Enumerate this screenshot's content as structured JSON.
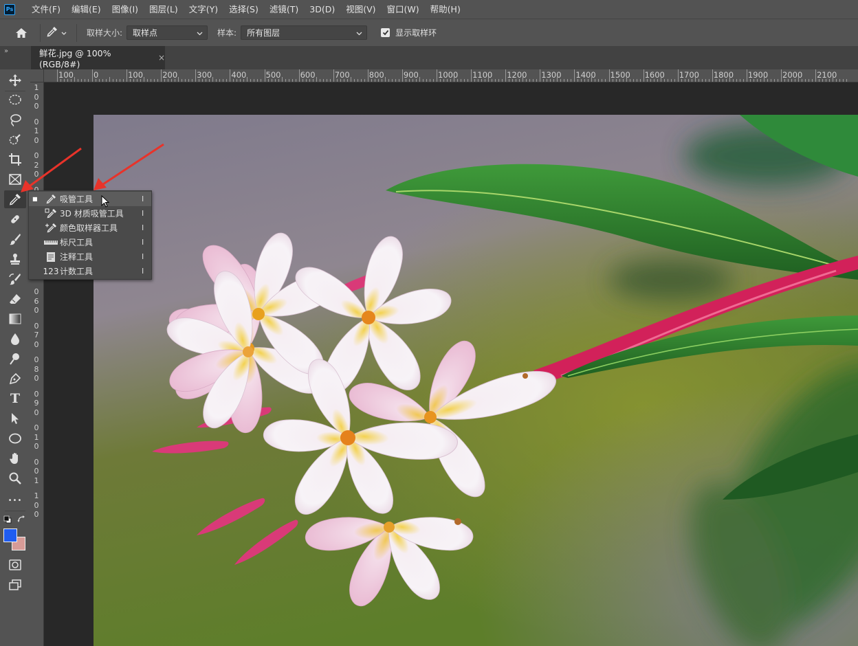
{
  "app": {
    "logo": "Ps"
  },
  "menu": [
    "文件(F)",
    "编辑(E)",
    "图像(I)",
    "图层(L)",
    "文字(Y)",
    "选择(S)",
    "滤镜(T)",
    "3D(D)",
    "视图(V)",
    "窗口(W)",
    "帮助(H)"
  ],
  "options": {
    "sample_size_label": "取样大小:",
    "sample_size_value": "取样点",
    "sample_label": "样本:",
    "sample_value": "所有图层",
    "show_ring_label": "显示取样环",
    "show_ring_checked": true
  },
  "tabs": {
    "collapse": "»",
    "document_title": "鲜花.jpg @ 100%(RGB/8#)",
    "close": "×"
  },
  "ruler": {
    "top_labels": [
      "100",
      "0",
      "100",
      "200",
      "300",
      "400",
      "500",
      "600",
      "700",
      "800",
      "900",
      "1000",
      "1100",
      "1200",
      "1300",
      "1400",
      "1500",
      "1600",
      "1700",
      "1800",
      "1900",
      "2000",
      "2100"
    ],
    "left_labels": [
      "1",
      "0",
      "0",
      "0",
      "1",
      "0",
      "0",
      "2",
      "0",
      "0",
      "3",
      "0",
      "0",
      "4",
      "0",
      "0",
      "5",
      "0",
      "0",
      "6",
      "0",
      "0",
      "7",
      "0",
      "0",
      "8",
      "0",
      "0",
      "9",
      "0",
      "0",
      "1",
      "0",
      "0",
      "0",
      "1",
      "1",
      "0",
      "0"
    ]
  },
  "toolbar": {
    "tools": [
      "move-tool",
      "marquee-tool",
      "lasso-tool",
      "quick-select-tool",
      "crop-tool",
      "frame-tool",
      "eyedropper-tool",
      "healing-brush-tool",
      "brush-tool",
      "clone-stamp-tool",
      "history-brush-tool",
      "eraser-tool",
      "gradient-tool",
      "blur-tool",
      "dodge-tool",
      "pen-tool",
      "type-tool",
      "path-select-tool",
      "ellipse-tool",
      "hand-tool",
      "zoom-tool",
      "more-tools",
      "default-colors",
      "swap-colors",
      "foreground-color",
      "background-color",
      "quick-mask",
      "screen-mode"
    ],
    "type_tool_glyph": "T",
    "more_glyph": "•••",
    "foreground_color": "#1f5cf0",
    "background_color": "#d79b97"
  },
  "flyout": {
    "items": [
      {
        "label": "吸管工具",
        "key": "I",
        "icon": "eyedropper-icon",
        "selected": true,
        "bullet": "■"
      },
      {
        "label": "3D 材质吸管工具",
        "key": "I",
        "icon": "3d-material-eyedropper-icon",
        "selected": false,
        "bullet": ""
      },
      {
        "label": "颜色取样器工具",
        "key": "I",
        "icon": "color-sampler-icon",
        "selected": false,
        "bullet": ""
      },
      {
        "label": "标尺工具",
        "key": "I",
        "icon": "ruler-icon",
        "selected": false,
        "bullet": ""
      },
      {
        "label": "注释工具",
        "key": "I",
        "icon": "note-icon",
        "selected": false,
        "bullet": ""
      },
      {
        "label": "计数工具",
        "key": "I",
        "icon": "count-icon",
        "selected": false,
        "bullet": "",
        "icon_text": "123"
      }
    ]
  },
  "annotations": {
    "arrow_color": "#e8332a"
  }
}
